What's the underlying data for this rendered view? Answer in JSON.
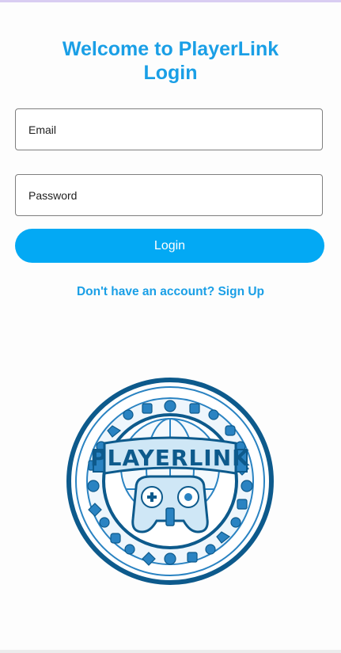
{
  "header": {
    "title_line1": "Welcome to PlayerLink",
    "title_line2": "Login"
  },
  "form": {
    "email_placeholder": "Email",
    "password_placeholder": "Password",
    "login_label": "Login"
  },
  "signup": {
    "link_text": "Don't have an account? Sign Up"
  },
  "logo": {
    "icon": "playerlink-logo",
    "colors": {
      "accent": "#1a9fe6",
      "button": "#03a9f4",
      "logo_dark": "#0d5a8c",
      "logo_mid": "#2a83c2",
      "logo_light": "#cfe7f6"
    }
  }
}
